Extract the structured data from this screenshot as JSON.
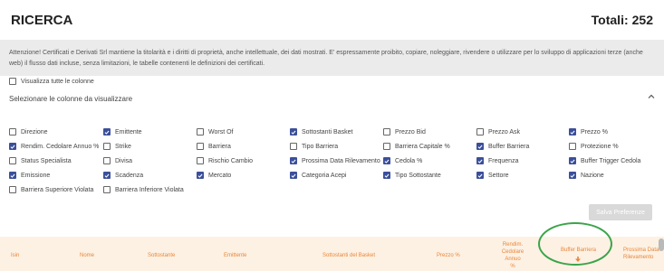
{
  "header": {
    "title": "RICERCA",
    "total_label": "Totali:",
    "total_value": "252"
  },
  "notice": {
    "text": "Attenzione! Certificati e Derivati Srl mantiene la titolarità e i diritti di proprietà, anche intellettuale, dei dati mostrati. E' espressamente proibito, copiare, noleggiare, rivendere o utilizzare per lo sviluppo di applicazioni terze (anche web) il flusso dati incluse, senza limitazioni, le tabelle contenenti le definizioni dei certificati."
  },
  "columns_panel": {
    "title": "Selezionare le colonne da visualizzare",
    "check_all": {
      "label": "Visualizza tutte le colonne",
      "checked": false
    },
    "rows": [
      [
        {
          "label": "Direzione",
          "checked": false
        },
        {
          "label": "Emittente",
          "checked": true
        },
        {
          "label": "Worst Of",
          "checked": false
        },
        {
          "label": "Sottostanti Basket",
          "checked": true
        },
        {
          "label": "Prezzo Bid",
          "checked": false
        },
        {
          "label": "Prezzo Ask",
          "checked": false
        },
        {
          "label": "Prezzo %",
          "checked": true
        }
      ],
      [
        {
          "label": "Rendim. Cedolare Annuo %",
          "checked": true
        },
        {
          "label": "Strike",
          "checked": false
        },
        {
          "label": "Barriera",
          "checked": false
        },
        {
          "label": "Tipo Barriera",
          "checked": false
        },
        {
          "label": "Barriera Capitale %",
          "checked": false
        },
        {
          "label": "Buffer Barriera",
          "checked": true
        },
        {
          "label": "Protezione %",
          "checked": false
        }
      ],
      [
        {
          "label": "Status Specialista",
          "checked": false
        },
        {
          "label": "Divisa",
          "checked": false
        },
        {
          "label": "Rischio Cambio",
          "checked": false
        },
        {
          "label": "Prossima Data Rilevamento",
          "checked": true
        },
        {
          "label": "Cedola %",
          "checked": true
        },
        {
          "label": "Frequenza",
          "checked": true
        },
        {
          "label": "Buffer Trigger Cedola",
          "checked": true
        }
      ],
      [
        {
          "label": "Emissione",
          "checked": true
        },
        {
          "label": "Scadenza",
          "checked": true
        },
        {
          "label": "Mercato",
          "checked": true
        },
        {
          "label": "Categoria Acepi",
          "checked": true
        },
        {
          "label": "Tipo Sottostante",
          "checked": true
        },
        {
          "label": "Settore",
          "checked": true
        },
        {
          "label": "Nazione",
          "checked": true
        }
      ],
      [
        {
          "label": "Barriera Superiore Violata",
          "checked": false
        },
        {
          "label": "Barriera Inferiore Violata",
          "checked": false
        }
      ]
    ],
    "save_label": "Salva Preferenze"
  },
  "table": {
    "columns": {
      "isin": "Isin",
      "nome": "Nome",
      "sottostante": "Sottostante",
      "emittente": "Emittente",
      "basket": "Sottostanti del Basket",
      "prezzo": "Prezzo %",
      "rendim_1": "Rendim.",
      "rendim_2": "Cedolare Annuo",
      "rendim_3": "%",
      "buffer": "Buffer Barriera",
      "data_1": "Prossima Data",
      "data_2": "Rilevamento"
    }
  },
  "colors": {
    "accent_check": "#3b4f9a",
    "header_text": "#e8863a",
    "header_bg": "#fdf1e3",
    "highlight": "#3aa44a"
  }
}
